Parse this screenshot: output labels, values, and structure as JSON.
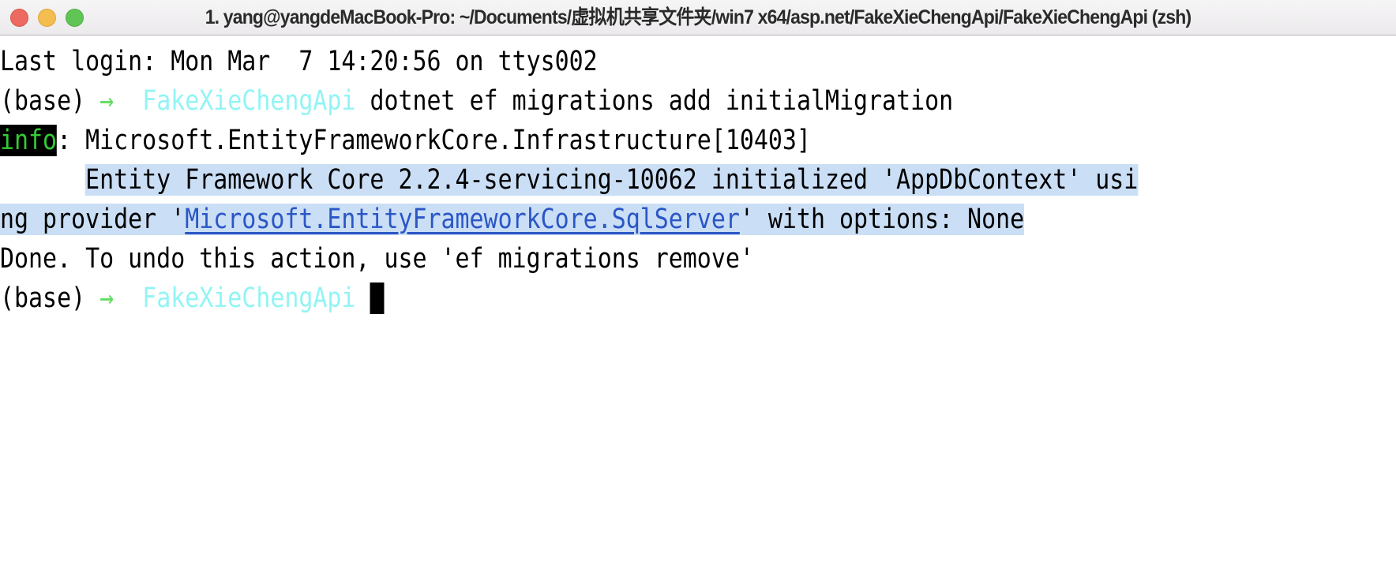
{
  "window": {
    "title": "1. yang@yangdeMacBook-Pro: ~/Documents/虚拟机共享文件夹/win7 x64/asp.net/FakeXieChengApi/FakeXieChengApi (zsh)",
    "traffic_lights": {
      "close": "close-button",
      "minimize": "minimize-button",
      "zoom": "zoom-button"
    }
  },
  "colors": {
    "background": "#ffffff",
    "foreground": "#000000",
    "cyan": "#92f4f4",
    "green_arrow": "#62dc62",
    "info_text": "#33cc33",
    "info_bg": "#000000",
    "selection": "#cadef5",
    "link": "#2a56c6",
    "titlebar": "#eceaec"
  },
  "terminal": {
    "line1": {
      "text": "Last login: Mon Mar  7 14:20:56 on ttys002"
    },
    "line2": {
      "conda_env": "(base) ",
      "arrow": "→",
      "gap1": "  ",
      "directory": "FakeXieChengApi",
      "gap2": " ",
      "command": "dotnet ef migrations add initialMigration"
    },
    "line3": {
      "level": "info",
      "rest": ": Microsoft.EntityFrameworkCore.Infrastructure[10403]"
    },
    "line4": {
      "indent": "      ",
      "text": "Entity Framework Core 2.2.4-servicing-10062 initialized 'AppDbContext' usi"
    },
    "line5": {
      "before_link": "ng provider '",
      "link": "Microsoft.EntityFrameworkCore.SqlServer",
      "after_link": "' with options: None"
    },
    "line6": {
      "text": "Done. To undo this action, use 'ef migrations remove'"
    },
    "line7": {
      "conda_env": "(base) ",
      "arrow": "→",
      "gap1": "  ",
      "directory": "FakeXieChengApi",
      "gap2": " ",
      "cursor": " "
    }
  }
}
